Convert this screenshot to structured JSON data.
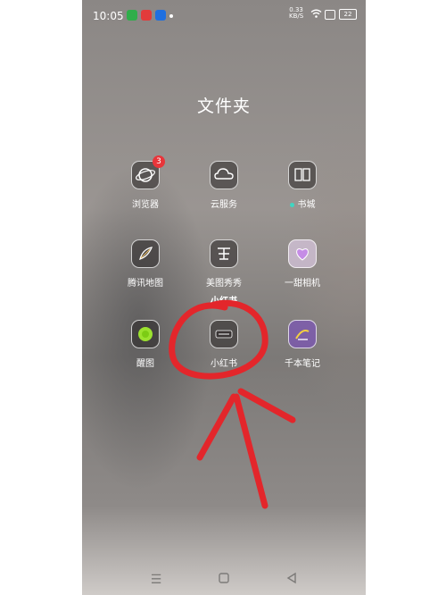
{
  "status_bar": {
    "time": "10:05",
    "net_speed_value": "0.33",
    "net_speed_unit": "KB/S",
    "battery": "22"
  },
  "folder": {
    "title": "文件夹"
  },
  "apps": [
    {
      "label": "浏览器",
      "badge": "3",
      "icon": "browser-icon"
    },
    {
      "label": "云服务",
      "icon": "cloud-icon"
    },
    {
      "label": "书城",
      "icon": "book-icon"
    },
    {
      "label": "腾讯地图",
      "icon": "map-icon"
    },
    {
      "label": "美图秀秀",
      "icon": "meitu-icon"
    },
    {
      "label": "一甜相机",
      "icon": "camera-icon"
    },
    {
      "label": "醒图",
      "icon": "xingtu-icon"
    },
    {
      "label": "小红书",
      "icon": "xiaohongshu-icon",
      "overlay_caption": "小红书"
    },
    {
      "label": "千本笔记",
      "icon": "notes-icon"
    }
  ],
  "nav": {
    "menu_icon": "menu-icon",
    "home_icon": "home-icon",
    "back_icon": "back-icon"
  },
  "colors": {
    "badge": "#e8353a",
    "annotation": "#e3262b",
    "green_dot": "#3fd6c1"
  }
}
